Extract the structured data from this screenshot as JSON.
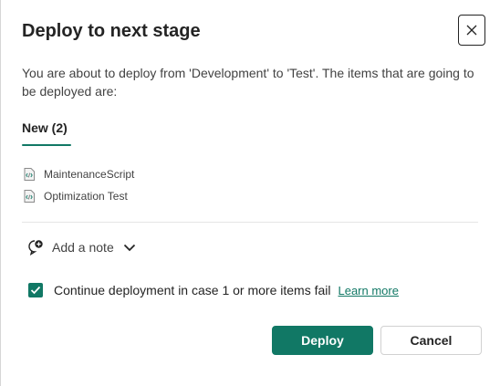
{
  "dialog": {
    "title": "Deploy to next stage",
    "description": "You are about to deploy from 'Development' to 'Test'. The items that are going to be deployed are:",
    "tab_label": "New (2)",
    "items": [
      {
        "name": "MaintenanceScript",
        "icon": "script-file-icon"
      },
      {
        "name": "Optimization Test",
        "icon": "script-file-icon"
      }
    ],
    "add_note_label": "Add a note",
    "continue_label": "Continue deployment in case 1 or more items fail",
    "continue_checked": true,
    "learn_more_label": "Learn more",
    "deploy_label": "Deploy",
    "cancel_label": "Cancel"
  },
  "colors": {
    "accent": "#117865",
    "text": "#242424",
    "secondary_text": "#424242",
    "divider": "#e5e5e5"
  }
}
